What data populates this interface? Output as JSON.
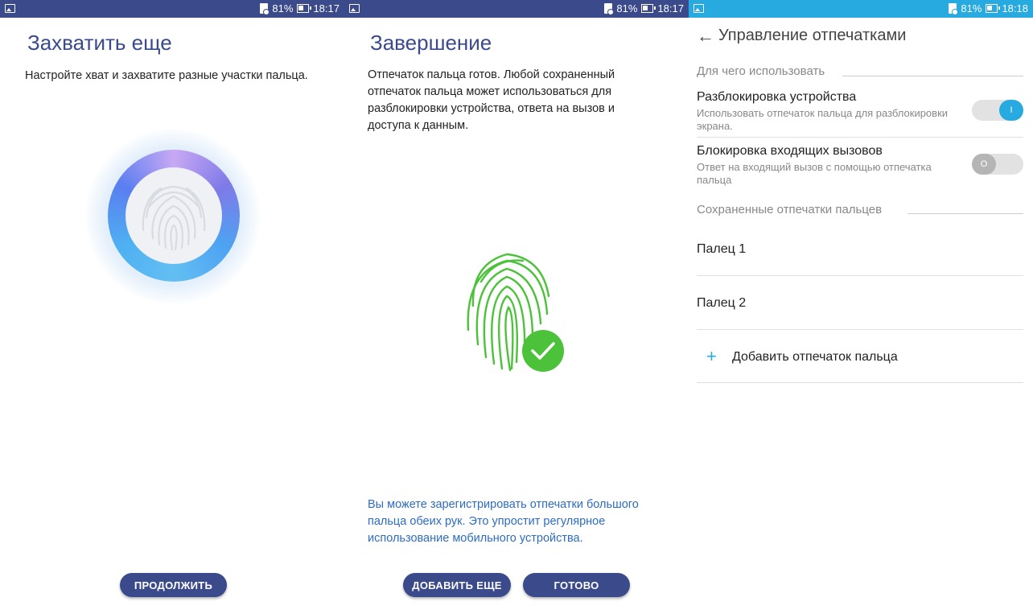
{
  "status": {
    "s1": {
      "battery": "81%",
      "time": "18:17"
    },
    "s2": {
      "battery": "81%",
      "time": "18:17"
    },
    "s3": {
      "battery": "81%",
      "time": "18:18"
    }
  },
  "screen1": {
    "title": "Захватить еще",
    "instruction": "Настройте хват и захватите разные участки пальца.",
    "continue_label": "ПРОДОЛЖИТЬ"
  },
  "screen2": {
    "title": "Завершение",
    "body": "Отпечаток пальца готов. Любой сохраненный отпечаток пальца может использоваться для разблокировки устройства, ответа на вызов и доступа к данным.",
    "note": "Вы можете зарегистрировать отпечатки большого пальца обеих рук. Это упростит регулярное использование мобильного устройства.",
    "add_more_label": "ДОБАВИТЬ ЕЩЕ",
    "done_label": "ГОТОВО"
  },
  "screen3": {
    "title": "Управление отпечатками",
    "usage_section": "Для чего использовать",
    "prefs": [
      {
        "title": "Разблокировка устройства",
        "subtitle": "Использовать отпечаток пальца для разблокировки экрана.",
        "state": "on",
        "knob": "I"
      },
      {
        "title": "Блокировка входящих вызовов",
        "subtitle": "Ответ на входящий вызов с помощью отпечатка пальца",
        "state": "off",
        "knob": "O"
      }
    ],
    "saved_section": "Сохраненные отпечатки пальцев",
    "fingers": [
      "Палец 1",
      "Палец 2"
    ],
    "add_label": "Добавить отпечаток пальца"
  },
  "colors": {
    "primary": "#3b4a8a",
    "accent": "#27aadf",
    "success": "#4cc23a",
    "note": "#2d6cc0"
  }
}
